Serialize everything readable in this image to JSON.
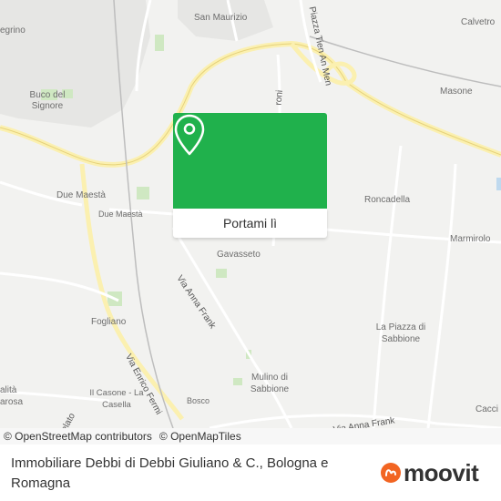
{
  "map": {
    "places": {
      "san_maurizio": "San Maurizio",
      "calvetro": "Calvetro",
      "regrino": "egrino",
      "buco_del_signore": "Buco del Signore",
      "masone": "Masone",
      "due_maesta_1": "Due Maestà",
      "due_maesta_2": "Due Maestà",
      "roncadella": "Roncadella",
      "marmirolo": "Marmirolo",
      "gavasseto": "Gavasseto",
      "fogliano": "Fogliano",
      "la_piazza_di_sabbione": "La Piazza di Sabbione",
      "mulino_di_sabbione": "Mulino di Sabbione",
      "il_casone_la_casella": "Il Casone - La Casella",
      "bosco": "Bosco",
      "cacci": "Cacci",
      "alita_sarosa": "alità arosa"
    },
    "streets": {
      "piazza_tien_an_men": "Piazza Tien An Men",
      "via_anna_frank_1": "Via Anna Frank",
      "via_anna_frank_2": "Via Anna Frank",
      "via_enrico_fermi": "Via Enrico Fermi",
      "via_roni": "roni",
      "via_elato": "elato"
    }
  },
  "popup": {
    "button_label": "Portami lì",
    "pin_icon": "location-pin-icon",
    "color": "#20b14c"
  },
  "attribution": {
    "osm_contributors": "© OpenStreetMap contributors",
    "openmaptiles": "© OpenMapTiles"
  },
  "footer": {
    "title": "Immobiliare Debbi di Debbi Giuliano & C., Bologna e Romagna"
  },
  "logo": {
    "text": "moovit",
    "brand_color": "#f26522"
  }
}
